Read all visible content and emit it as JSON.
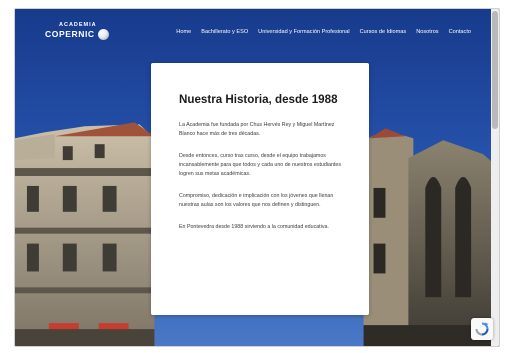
{
  "brand": {
    "line1": "ACADEMIA",
    "line2": "COPERNIC"
  },
  "nav": {
    "items": [
      {
        "label": "Home"
      },
      {
        "label": "Bachillerato y ESO"
      },
      {
        "label": "Universidad y Formación Profesional"
      },
      {
        "label": "Cursos de Idiomas"
      },
      {
        "label": "Nosotros"
      },
      {
        "label": "Contacto"
      }
    ]
  },
  "card": {
    "title": "Nuestra Historia, desde 1988",
    "paragraphs": [
      "La Academia fue fundada por Chus Hervés Rey y Miguel Martínez Blanco hace más de tres décadas.",
      "Desde entonces, curso tras curso, desde el equipo trabajamos incansablemente para que todos y cada uno de nuestros estudiantes logren sus metas académicas.",
      "Compromiso, dedicación e implicación con los jóvenes que llenan nuestras aulas son los valores que nos definen y distinguen.",
      "En Pontevedra desde 1988 sirviendo a la comunidad educativa."
    ]
  },
  "colors": {
    "sky": "#1c3f8f",
    "card": "#ffffff",
    "title": "#1b1b1b",
    "body_text": "#3a3a3a"
  },
  "icons": {
    "logo": "globe-icon",
    "recaptcha": "recaptcha-icon"
  }
}
